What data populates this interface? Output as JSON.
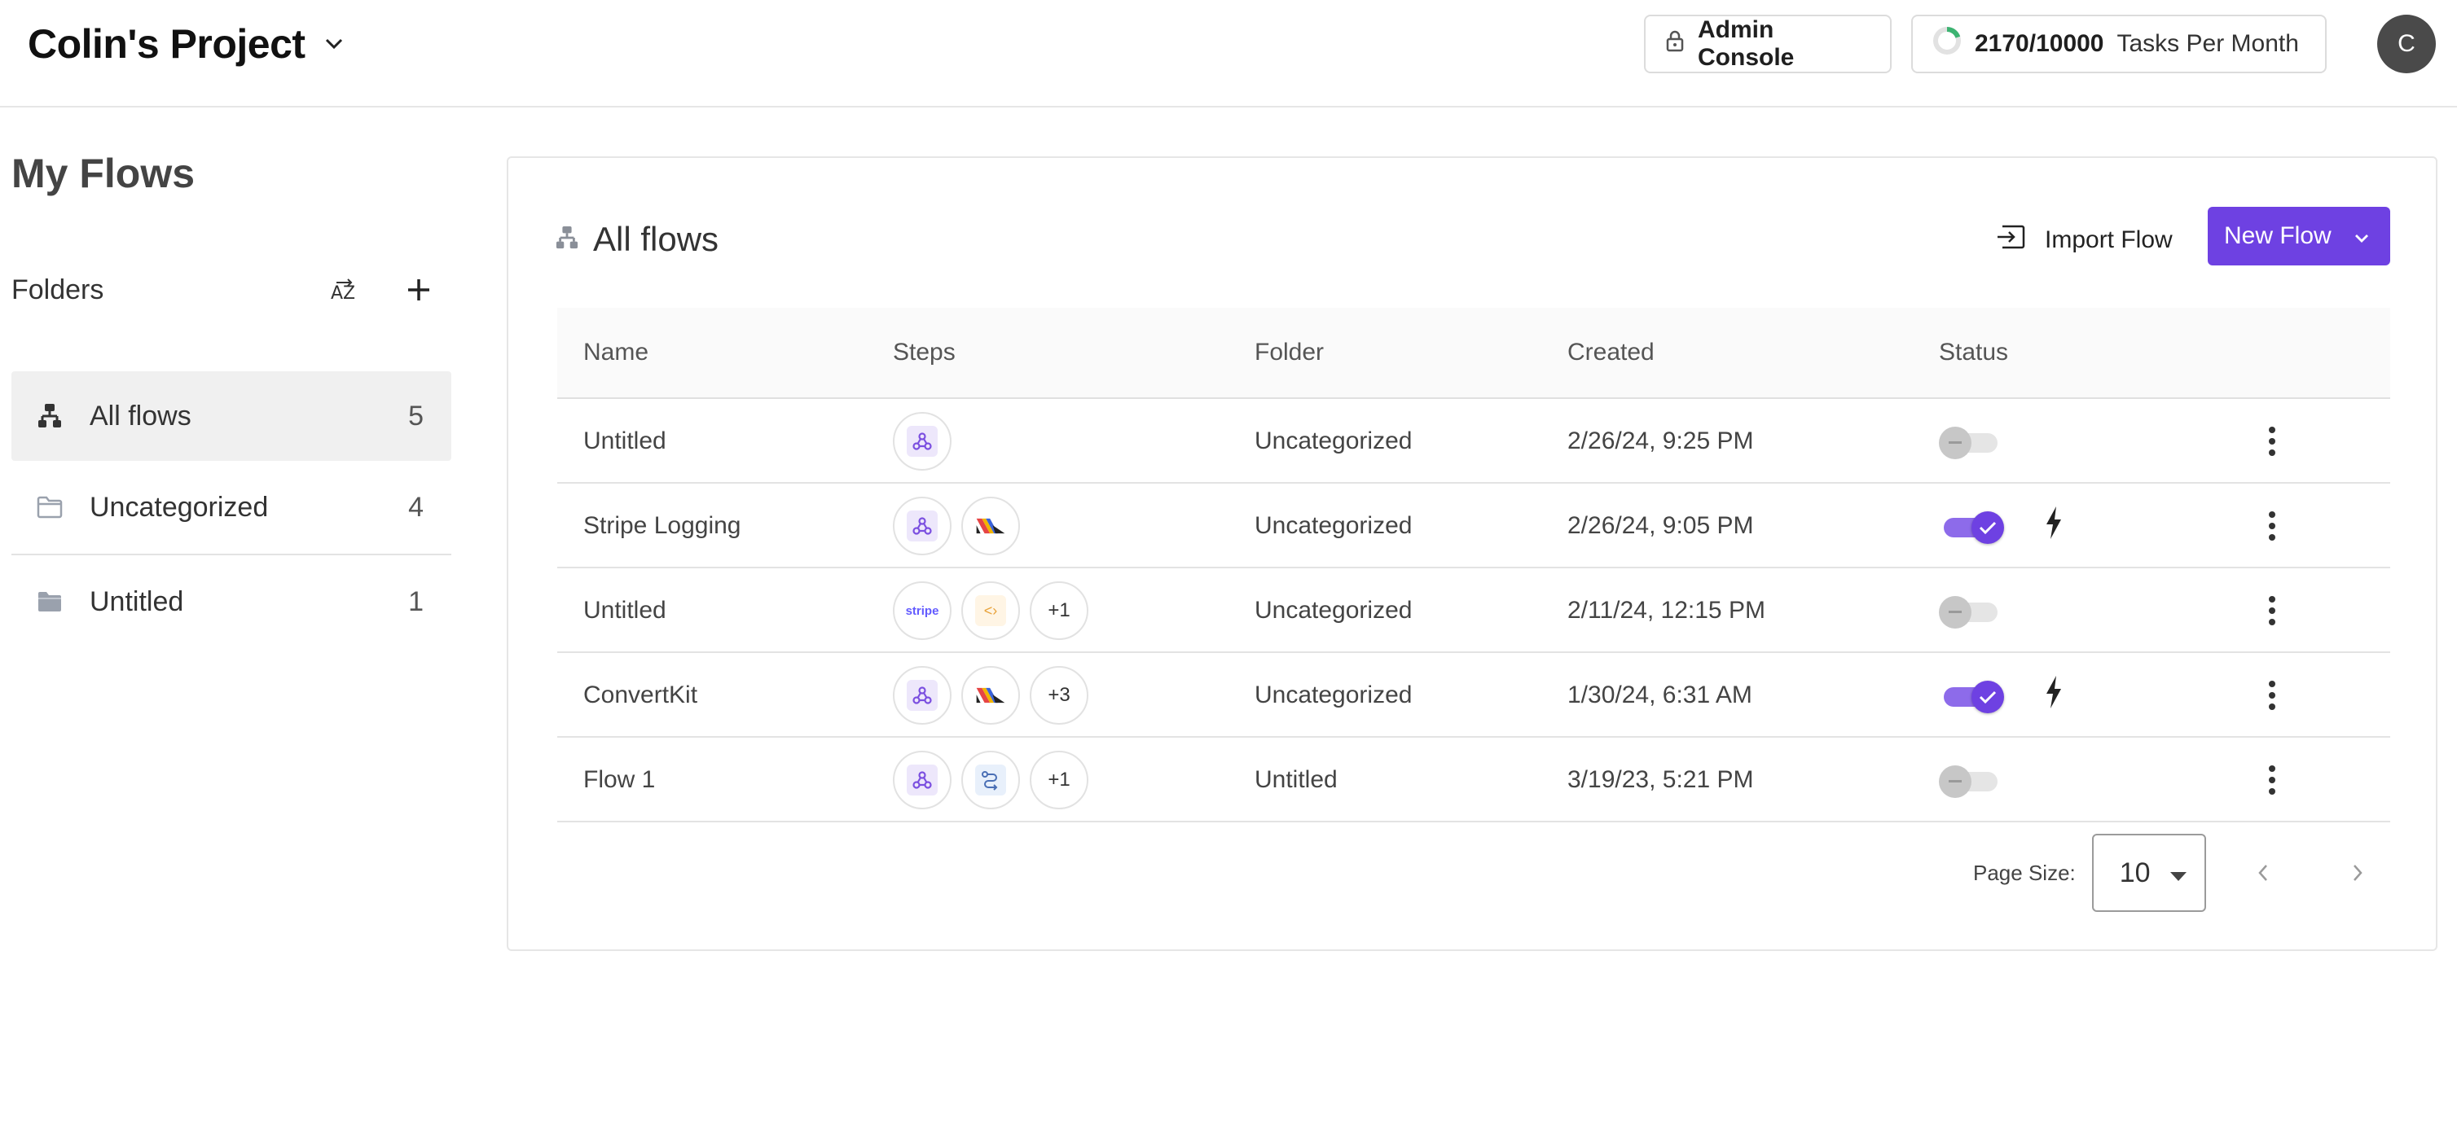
{
  "header": {
    "project_name": "Colin's Project",
    "admin_console_label": "Admin Console",
    "tasks_count": "2170/10000",
    "tasks_label": "Tasks Per Month",
    "avatar_initial": "C"
  },
  "sidebar": {
    "title": "My Flows",
    "folders_label": "Folders",
    "sort_label": "AZ",
    "items": [
      {
        "label": "All flows",
        "count": "5",
        "icon": "flow-icon",
        "selected": true
      },
      {
        "label": "Uncategorized",
        "count": "4",
        "icon": "folder-outline-icon",
        "selected": false
      },
      {
        "label": "Untitled",
        "count": "1",
        "icon": "folder-filled-icon",
        "selected": false
      }
    ]
  },
  "main": {
    "title": "All flows",
    "import_label": "Import Flow",
    "new_flow_label": "New Flow",
    "columns": [
      "Name",
      "Steps",
      "Folder",
      "Created",
      "Status"
    ],
    "rows": [
      {
        "name": "Untitled",
        "steps": [
          "webhook-icon"
        ],
        "more": "",
        "folder": "Uncategorized",
        "created": "2/26/24, 9:25 PM",
        "enabled": false,
        "trigger": false
      },
      {
        "name": "Stripe Logging",
        "steps": [
          "webhook-icon",
          "blocks-icon"
        ],
        "more": "",
        "folder": "Uncategorized",
        "created": "2/26/24, 9:05 PM",
        "enabled": true,
        "trigger": true
      },
      {
        "name": "Untitled",
        "steps": [
          "stripe-icon",
          "code-icon"
        ],
        "more": "+1",
        "folder": "Uncategorized",
        "created": "2/11/24, 12:15 PM",
        "enabled": false,
        "trigger": false
      },
      {
        "name": "ConvertKit",
        "steps": [
          "webhook-icon",
          "blocks-icon"
        ],
        "more": "+3",
        "folder": "Uncategorized",
        "created": "1/30/24, 6:31 AM",
        "enabled": true,
        "trigger": true
      },
      {
        "name": "Flow 1",
        "steps": [
          "webhook-icon",
          "flow-branch-icon"
        ],
        "more": "+1",
        "folder": "Untitled",
        "created": "3/19/23, 5:21 PM",
        "enabled": false,
        "trigger": false
      }
    ],
    "stripe_text": "stripe",
    "pager": {
      "label": "Page Size:",
      "size": "10"
    }
  },
  "colors": {
    "accent": "#6e41e2"
  }
}
